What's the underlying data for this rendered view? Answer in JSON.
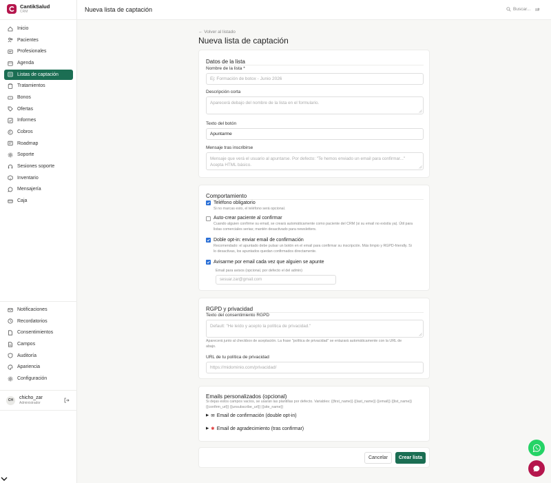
{
  "brand": {
    "name": "CantikSalud",
    "sub": "CRM"
  },
  "topbar": {
    "title": "Nueva lista de captación",
    "search_placeholder": "Buscar..."
  },
  "nav": [
    {
      "label": "Inicio",
      "icon": "home-icon"
    },
    {
      "label": "Pacientes",
      "icon": "users-icon"
    },
    {
      "label": "Profesionales",
      "icon": "id-card-icon"
    },
    {
      "label": "Agenda",
      "icon": "calendar-icon"
    },
    {
      "label": "Listas de captación",
      "icon": "list-icon",
      "active": true
    },
    {
      "label": "Tratamientos",
      "icon": "clipboard-icon"
    },
    {
      "label": "Bonos",
      "icon": "ticket-icon"
    },
    {
      "label": "Ofertas",
      "icon": "tag-icon"
    },
    {
      "label": "Informes",
      "icon": "chart-icon"
    },
    {
      "label": "Cobros",
      "icon": "euro-icon"
    },
    {
      "label": "Roadmap",
      "icon": "map-icon"
    },
    {
      "label": "Soporte",
      "icon": "gear-icon"
    },
    {
      "label": "Sesiones soporte",
      "icon": "headset-icon"
    },
    {
      "label": "Inventario",
      "icon": "box-icon"
    },
    {
      "label": "Mensajería",
      "icon": "chat-icon"
    },
    {
      "label": "Caja",
      "icon": "cash-icon"
    }
  ],
  "nav_bottom": [
    {
      "label": "Notificaciones",
      "icon": "mail-icon"
    },
    {
      "label": "Recordatorios",
      "icon": "clock-icon"
    },
    {
      "label": "Consentimientos",
      "icon": "file-icon"
    },
    {
      "label": "Campos",
      "icon": "document-icon"
    },
    {
      "label": "Auditoría",
      "icon": "shield-icon"
    },
    {
      "label": "Apariencia",
      "icon": "palette-icon"
    },
    {
      "label": "Configuración",
      "icon": "settings-icon"
    }
  ],
  "user": {
    "initials": "CH",
    "name": "chicho_zar",
    "role": "Administrador"
  },
  "page": {
    "back": "← Volver al listado",
    "title": "Nueva lista de captación"
  },
  "datos": {
    "title": "Datos de la lista",
    "name_label": "Nombre de la lista *",
    "name_placeholder": "Ej: Formación de botox - Junio 2026",
    "desc_label": "Descripción corta",
    "desc_placeholder": "Aparecerá debajo del nombre de la lista en el formulario.",
    "button_label": "Texto del botón",
    "button_value": "Apuntarme",
    "message_label": "Mensaje tras inscribirse",
    "message_placeholder": "Mensaje que verá el usuario al apuntarse. Por defecto: \"Te hemos enviado un email para confirmar...\" Acepta HTML básico."
  },
  "comportamiento": {
    "title": "Comportamiento",
    "phone_label": "Teléfono obligatorio",
    "phone_help": "Si no marcas esto, el teléfono será opcional.",
    "phone_checked": true,
    "autocreate_label": "Auto-crear paciente al confirmar",
    "autocreate_help1": "Cuando alguien confirme su email, se creará automáticamente como paciente del CRM (si su email no existía ya). Útil para",
    "autocreate_help2": "listas comerciales serias; mantén desactivado para newsletters.",
    "autocreate_checked": false,
    "double_label": "Doble opt-in: enviar email de confirmación",
    "double_help1": "Recomendado: el apuntado debe pulsar un botón en el email para confirmar su inscripción. Más limpio y RGPD-friendly. Si",
    "double_help2": "lo desactivas, los apuntados quedan confirmados directamente.",
    "double_checked": true,
    "notify_label": "Avisarme por email cada vez que alguien se apunte",
    "notify_checked": true,
    "notify_email_label": "Email para avisos (opcional, por defecto el del admin)",
    "notify_email_placeholder": "sesuar.zar@gmail.com"
  },
  "rgpd": {
    "title": "RGPD y privacidad",
    "consent_label": "Texto del consentimiento RGPD",
    "consent_placeholder": "Default: \"He leído y acepto la política de privacidad.\"",
    "consent_help1": "Aparecerá junto al checkbox de aceptación. La frase \"política de privacidad\" se enlazará automáticamente con la URL de",
    "consent_help2": "abajo.",
    "url_label": "URL de tu política de privacidad",
    "url_placeholder": "https://midominio.com/privacidad/"
  },
  "emails": {
    "title": "Emails personalizados (opcional)",
    "help1": "Si dejas estos campos vacíos, se usarán las plantillas por defecto. Variables: {{first_name}} {{last_name}} {{email}} {{list_name}}",
    "help2": "{{confirm_url}} {{unsubscribe_url}} {{site_name}}",
    "item1": "Email de confirmación (double opt-in)",
    "item2": "Email de agradecimiento (tras confirmar)"
  },
  "footer": {
    "cancel": "Cancelar",
    "create": "Crear lista"
  },
  "colors": {
    "accent": "#1b6e53",
    "brand": "#b5164d",
    "whatsapp": "#25d366",
    "checkbox": "#2a6fd6"
  }
}
